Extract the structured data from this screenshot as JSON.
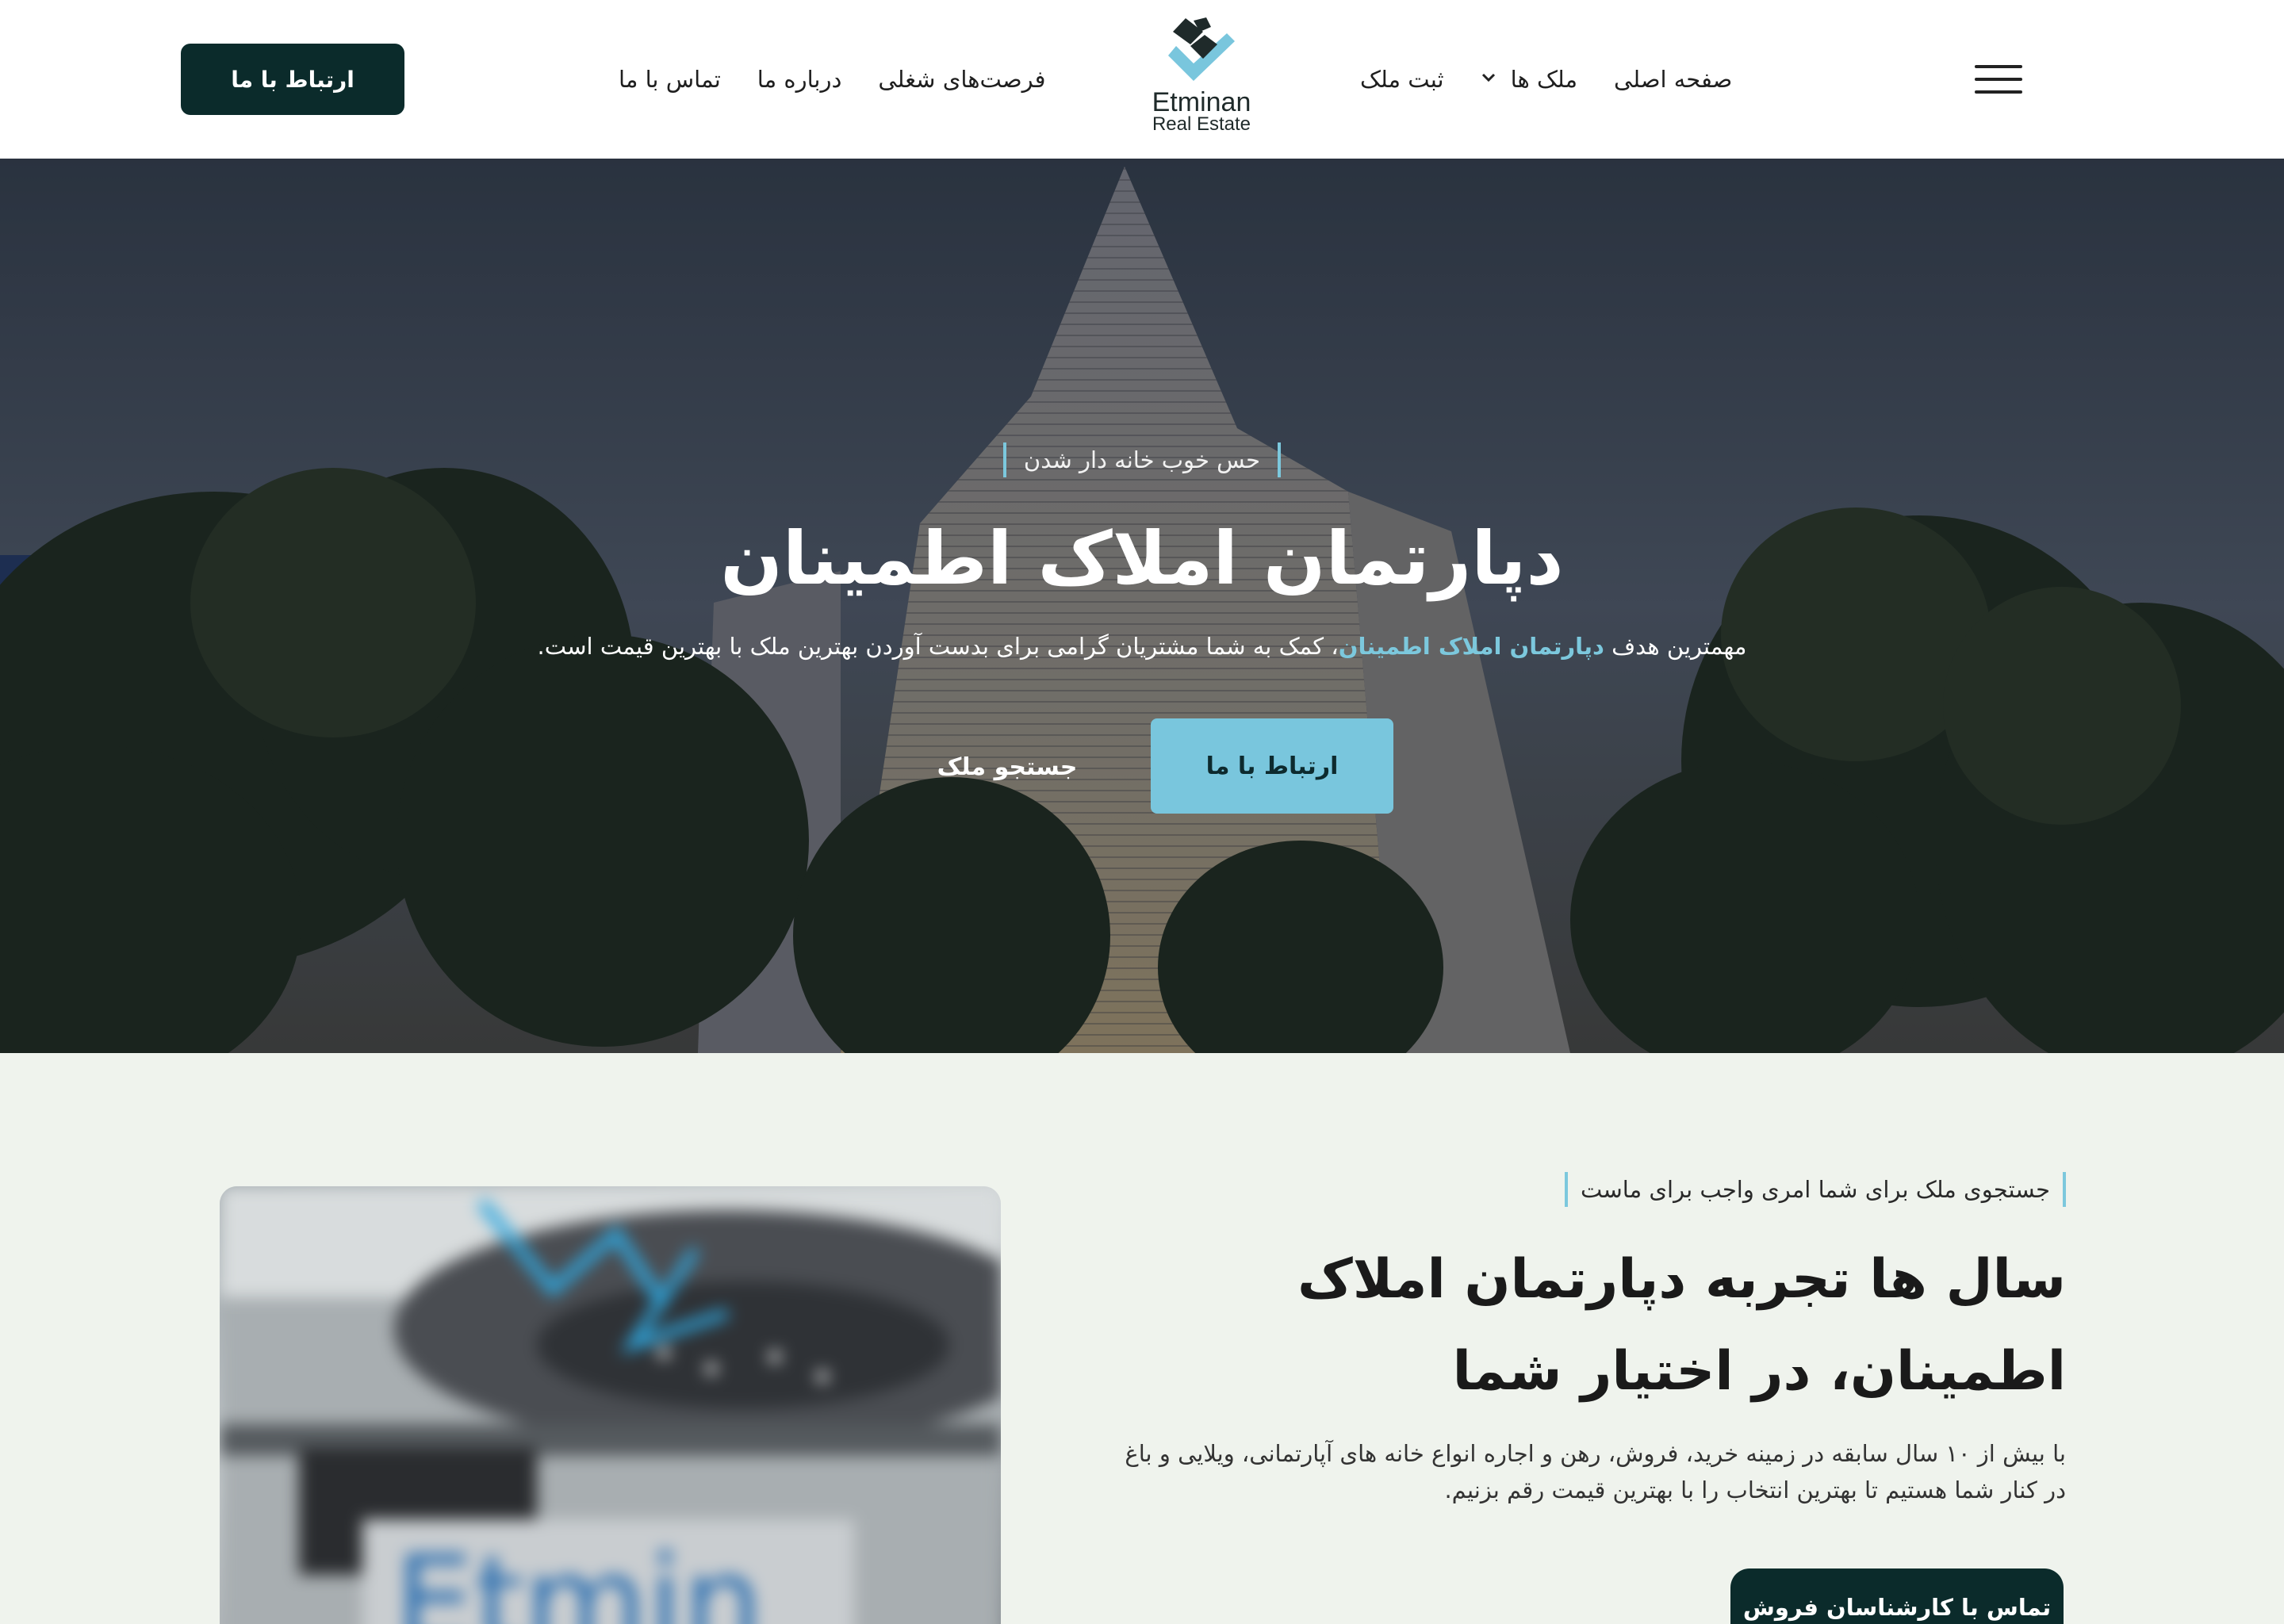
{
  "header": {
    "cta_label": "ارتباط با ما",
    "nav_left": [
      "فرصت‌های شغلی",
      "درباره ما",
      "تماس با ما"
    ],
    "nav_right": {
      "home": "صفحه اصلی",
      "properties": "ملک ها",
      "register": "ثبت ملک"
    },
    "logo": {
      "word": "Etminan",
      "sub": "Real Estate"
    },
    "menu_icon": "hamburger-icon"
  },
  "hero": {
    "eyebrow": "حس خوب خانه دار شدن",
    "title": "دپارتمان املاک اطمینان",
    "lead_before": "مهمترین هدف ",
    "lead_highlight": "دپارتمان املاک اطمینان",
    "lead_after": "، کمک به شما مشتریان گرامی برای بدست آوردن بهترین ملک با بهترین قیمت است.",
    "primary_button": "ارتباط با ما",
    "secondary_button": "جستجو ملک"
  },
  "about": {
    "eyebrow": "جستجوی ملک برای شما امری واجب برای ماست",
    "title_line1": "سال ها تجربه دپارتمان املاک",
    "title_line2": "اطمینان، در اختیار شما",
    "desc_line1": "با بیش از ۱۰ سال سابقه در زمینه خرید، فروش، رهن و اجاره انواع خانه های آپارتمانی، ویلایی و باغ",
    "desc_line2": "در کنار شما هستیم تا بهترین انتخاب را با بهترین قیمت رقم بزنیم.",
    "button": "تماس با کارشناسان فروش"
  },
  "colors": {
    "dark": "#0b2b2b",
    "accent": "#79c6dd",
    "section_bg": "#eff3ed"
  }
}
